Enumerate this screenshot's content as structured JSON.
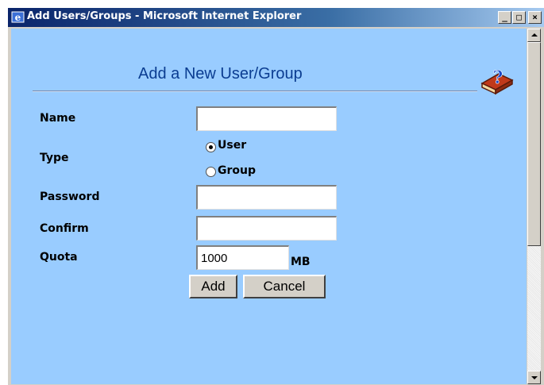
{
  "window": {
    "title": "Add Users/Groups - Microsoft Internet Explorer"
  },
  "form": {
    "heading": "Add a New User/Group",
    "name_label": "Name",
    "name_value": "",
    "type_label": "Type",
    "type_options": [
      {
        "label": "User",
        "checked": true
      },
      {
        "label": "Group",
        "checked": false
      }
    ],
    "password_label": "Password",
    "password_value": "",
    "confirm_label": "Confirm",
    "confirm_value": "",
    "quota_label": "Quota",
    "quota_value": "1000",
    "quota_unit": "MB",
    "add_label": "Add",
    "cancel_label": "Cancel"
  },
  "icons": {
    "ie_icon": "internet-explorer-icon",
    "help_icon": "help-book-icon"
  },
  "colors": {
    "title_gradient_start": "#0a246a",
    "title_gradient_end": "#a6caf0",
    "content_bg": "#99ccff",
    "heading_color": "#0b3d91",
    "chrome": "#d4d0c8"
  }
}
